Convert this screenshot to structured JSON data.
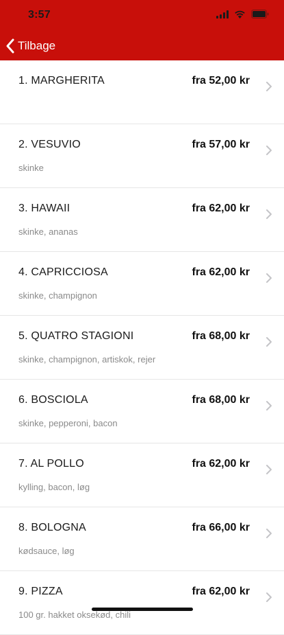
{
  "status_bar": {
    "time": "3:57"
  },
  "nav": {
    "back_label": "Tilbage"
  },
  "colors": {
    "accent": "#c80f0a"
  },
  "menu": [
    {
      "name": "1. MARGHERITA",
      "price": "fra 52,00 kr",
      "desc": ""
    },
    {
      "name": "2. VESUVIO",
      "price": "fra 57,00 kr",
      "desc": "skinke"
    },
    {
      "name": "3. HAWAII",
      "price": "fra 62,00 kr",
      "desc": "skinke, ananas"
    },
    {
      "name": "4. CAPRICCIOSA",
      "price": "fra 62,00 kr",
      "desc": "skinke, champignon"
    },
    {
      "name": "5. QUATRO STAGIONI",
      "price": "fra 68,00 kr",
      "desc": "skinke, champignon, artiskok, rejer"
    },
    {
      "name": "6. BOSCIOLA",
      "price": "fra 68,00 kr",
      "desc": "skinke, pepperoni, bacon"
    },
    {
      "name": "7. AL POLLO",
      "price": "fra 62,00 kr",
      "desc": "kylling, bacon, løg"
    },
    {
      "name": "8. BOLOGNA",
      "price": "fra 66,00 kr",
      "desc": "kødsauce, løg"
    },
    {
      "name": "9. PIZZA",
      "price": "fra 62,00 kr",
      "desc": "100 gr.  hakket oksekød, chili"
    }
  ]
}
